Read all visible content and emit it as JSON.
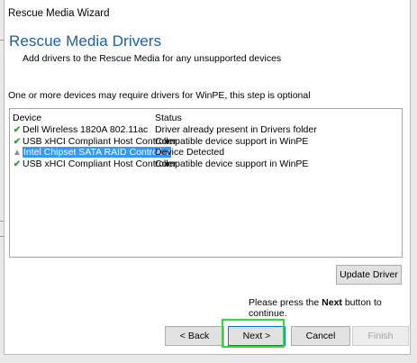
{
  "window": {
    "title": "Rescue Media Wizard"
  },
  "header": {
    "title": "Rescue Media Drivers",
    "subtitle": "Add drivers to the Rescue Media for any unsupported devices"
  },
  "info_text": "One or more devices may require drivers for WinPE, this step is optional",
  "list": {
    "columns": {
      "device": "Device",
      "status": "Status"
    },
    "rows": [
      {
        "icon": "check-icon",
        "device": "Dell Wireless 1820A 802.11ac",
        "status": "Driver already present in Drivers folder",
        "selected": false
      },
      {
        "icon": "check-icon",
        "device": "USB xHCI Compliant Host Controller",
        "status": "Compatible device support in WinPE",
        "selected": false
      },
      {
        "icon": "warning-icon",
        "device": "Intel Chipset SATA RAID Controller",
        "status": "Device Detected",
        "selected": true
      },
      {
        "icon": "check-icon",
        "device": "USB xHCI Compliant Host Controller",
        "status": "Compatible device support in WinPE",
        "selected": false
      }
    ]
  },
  "buttons": {
    "update_driver": "Update Driver",
    "back": "< Back",
    "next": "Next >",
    "cancel": "Cancel",
    "finish": "Finish"
  },
  "continue_message": {
    "prefix": "Please press the",
    "keyword": "Next",
    "suffix": "button to continue."
  },
  "colors": {
    "title_blue": "#1e5ea8",
    "selection": "#3399ff",
    "highlight_green": "#2ed93a",
    "check_green": "#2e9d3a"
  }
}
